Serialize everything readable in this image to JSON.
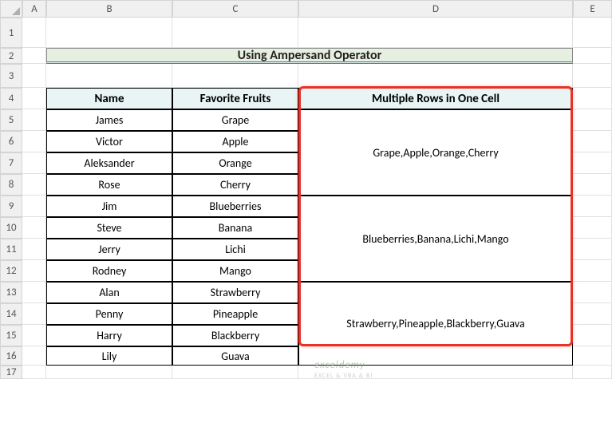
{
  "columns": [
    "A",
    "B",
    "C",
    "D",
    "E"
  ],
  "rows": [
    "1",
    "2",
    "3",
    "4",
    "5",
    "6",
    "7",
    "8",
    "9",
    "10",
    "11",
    "12",
    "13",
    "14",
    "15",
    "16",
    "17"
  ],
  "title": "Using Ampersand Operator",
  "headers": {
    "name": "Name",
    "fruits": "Favorite Fruits",
    "multi": "Multiple Rows in One Cell"
  },
  "data_rows": [
    {
      "name": "James",
      "fruit": "Grape"
    },
    {
      "name": "Victor",
      "fruit": "Apple"
    },
    {
      "name": "Aleksander",
      "fruit": "Orange"
    },
    {
      "name": "Rose",
      "fruit": "Cherry"
    },
    {
      "name": "Jim",
      "fruit": "Blueberries"
    },
    {
      "name": "Steve",
      "fruit": "Banana"
    },
    {
      "name": "Jerry",
      "fruit": "Lichi"
    },
    {
      "name": "Rodney",
      "fruit": "Mango"
    },
    {
      "name": "Alan",
      "fruit": "Strawberry"
    },
    {
      "name": "Penny",
      "fruit": "Pineapple"
    },
    {
      "name": "Harry",
      "fruit": "Blackberry"
    },
    {
      "name": "Lily",
      "fruit": "Guava"
    }
  ],
  "merged_results": [
    "Grape,Apple,Orange,Cherry",
    "Blueberries,Banana,Lichi,Mango",
    "Strawberry,Pineapple,Blackberry,Guava"
  ],
  "watermark": {
    "main": "exceldemy",
    "sub": "EXCEL & VBA & BI"
  }
}
